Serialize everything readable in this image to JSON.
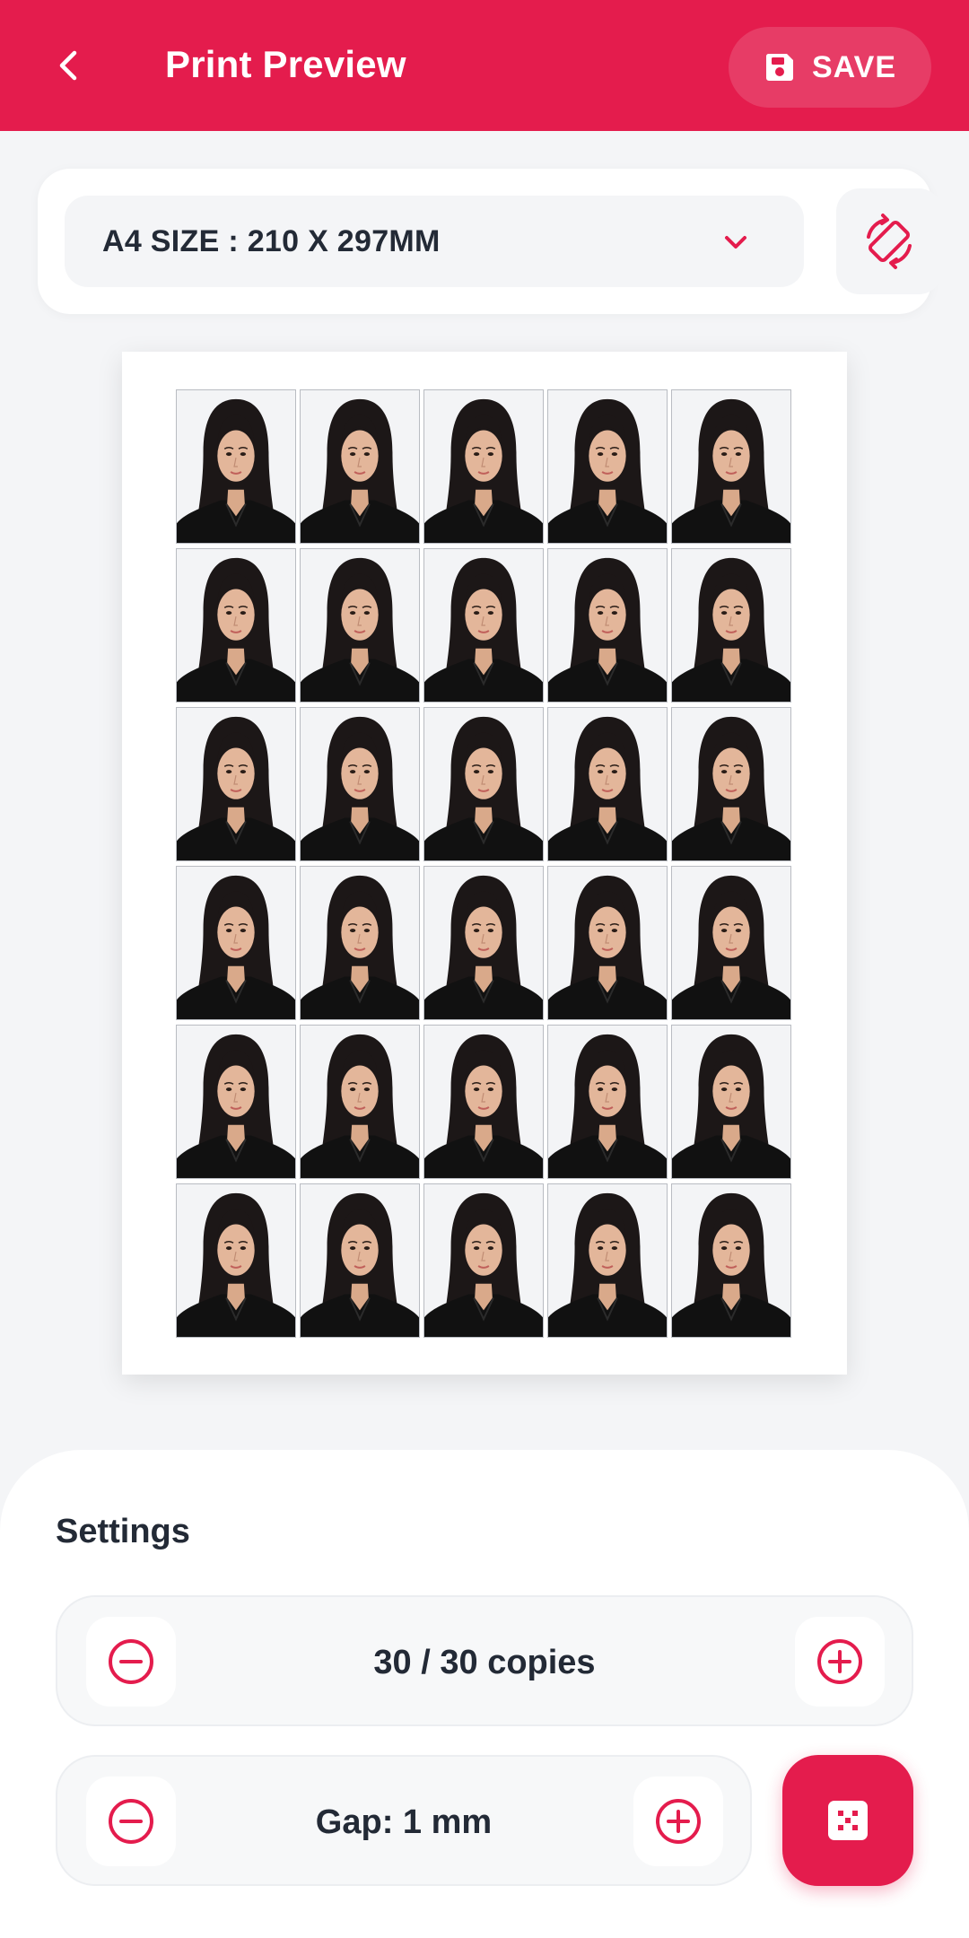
{
  "colors": {
    "accent": "#e41c4d",
    "background": "#f4f5f7",
    "text": "#232a36"
  },
  "header": {
    "back_icon": "chevron-left-icon",
    "title": "Print Preview",
    "save_icon": "floppy-disk-icon",
    "save_label": "SAVE"
  },
  "paper_size": {
    "selected": "A4 SIZE : 210 X 297MM",
    "dropdown_icon": "chevron-down-icon",
    "rotate_icon": "rotate-orientation-icon"
  },
  "preview": {
    "rows": 6,
    "columns": 5,
    "photo_count": 30
  },
  "settings": {
    "title": "Settings",
    "copies": {
      "text": "30 / 30 copies",
      "decrement_icon": "minus-circle-icon",
      "increment_icon": "plus-circle-icon"
    },
    "gap": {
      "text": "Gap: 1 mm",
      "decrement_icon": "minus-circle-icon",
      "increment_icon": "plus-circle-icon"
    },
    "layout_icon": "grid-layout-icon"
  }
}
